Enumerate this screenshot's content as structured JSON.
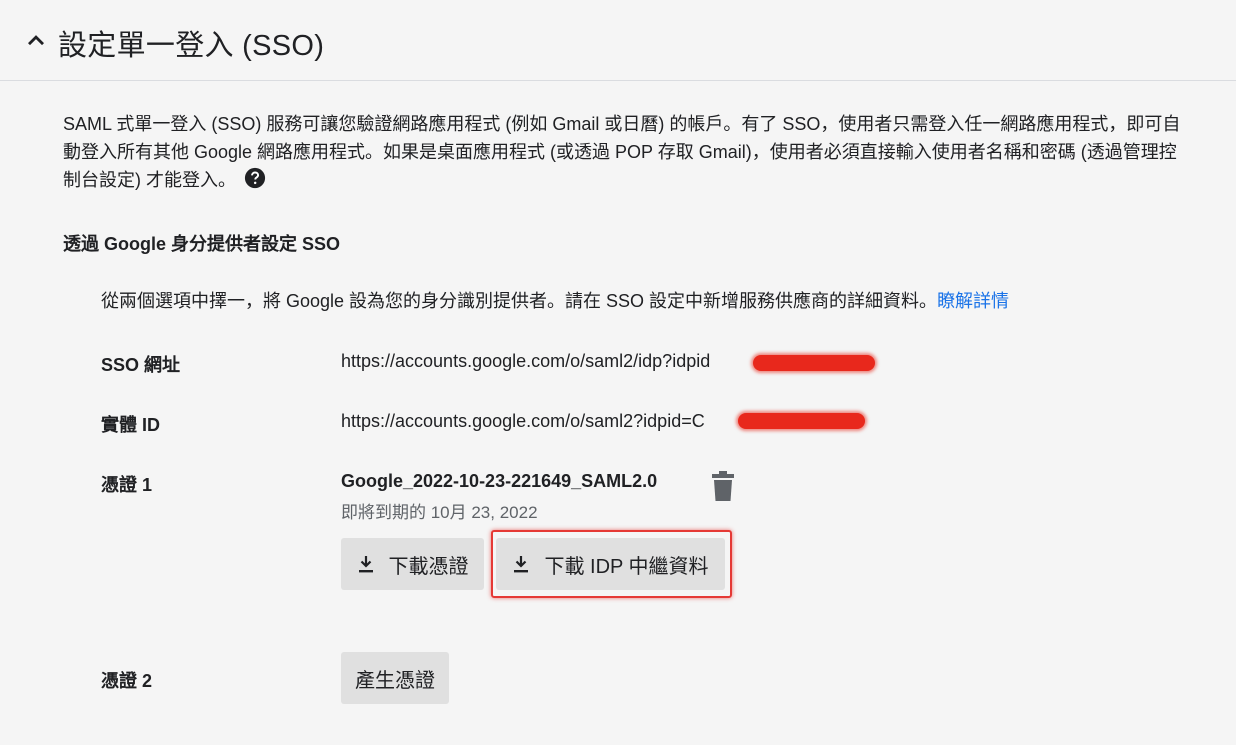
{
  "header": {
    "title": "設定單一登入 (SSO)",
    "chevron_icon": "chevron-up-icon"
  },
  "description": {
    "text": "SAML 式單一登入 (SSO) 服務可讓您驗證網路應用程式 (例如 Gmail 或日曆) 的帳戶。有了 SSO，使用者只需登入任一網路應用程式，即可自動登入所有其他 Google 網路應用程式。如果是桌面應用程式 (或透過 POP 存取 Gmail)，使用者必須直接輸入使用者名稱和密碼 (透過管理控制台設定) 才能登入。",
    "help_icon": "help-circle-icon"
  },
  "section": {
    "title": "透過 Google 身分提供者設定 SSO",
    "intro": "從兩個選項中擇一，將 Google 設為您的身分識別提供者。請在 SSO 設定中新增服務供應商的詳細資料。",
    "learn_more": "瞭解詳情"
  },
  "sso_url": {
    "label": "SSO 網址",
    "value": "https://accounts.google.com/o/saml2/idp?idpid"
  },
  "entity_id": {
    "label": "實體 ID",
    "value": "https://accounts.google.com/o/saml2?idpid=C"
  },
  "cert1": {
    "label": "憑證 1",
    "name": "Google_2022-10-23-221649_SAML2.0",
    "expires": "即將到期的 10月 23, 2022",
    "delete_icon": "trash-icon",
    "download_cert_label": "下載憑證",
    "download_idp_label": "下載 IDP 中繼資料",
    "download_icon": "download-icon"
  },
  "cert2": {
    "label": "憑證 2",
    "generate_label": "產生憑證"
  },
  "colors": {
    "background": "#f5f5f5",
    "button": "#e0e0e0",
    "link": "#1a73e8",
    "highlight": "#e53935"
  }
}
